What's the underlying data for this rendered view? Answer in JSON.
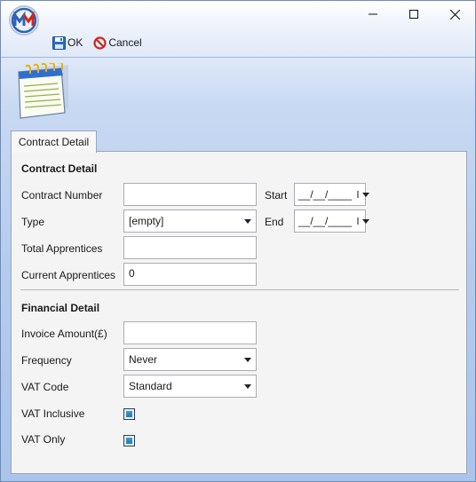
{
  "window": {
    "controls": {
      "minimize": "minimize",
      "maximize": "maximize",
      "close": "close"
    }
  },
  "toolbar": {
    "ok_label": "OK",
    "cancel_label": "Cancel"
  },
  "tab": {
    "label": "Contract Detail"
  },
  "contract": {
    "title": "Contract Detail",
    "contract_number_label": "Contract Number",
    "contract_number_value": "",
    "type_label": "Type",
    "type_value": "[empty]",
    "total_apprentices_label": "Total Apprentices",
    "total_apprentices_value": "",
    "current_apprentices_label": "Current Apprentices",
    "current_apprentices_value": "0",
    "start_label": "Start",
    "start_value": "__/__/____",
    "end_label": "End",
    "end_value": "__/__/____"
  },
  "financial": {
    "title": "Financial Detail",
    "invoice_amount_label": "Invoice Amount(£)",
    "invoice_amount_value": "",
    "frequency_label": "Frequency",
    "frequency_value": "Never",
    "vat_code_label": "VAT Code",
    "vat_code_value": "Standard",
    "vat_inclusive_label": "VAT Inclusive",
    "vat_only_label": "VAT Only"
  },
  "colors": {
    "accent": "#1e6fa8",
    "cancel_red": "#d0281c",
    "save_blue": "#2a6ebd"
  }
}
